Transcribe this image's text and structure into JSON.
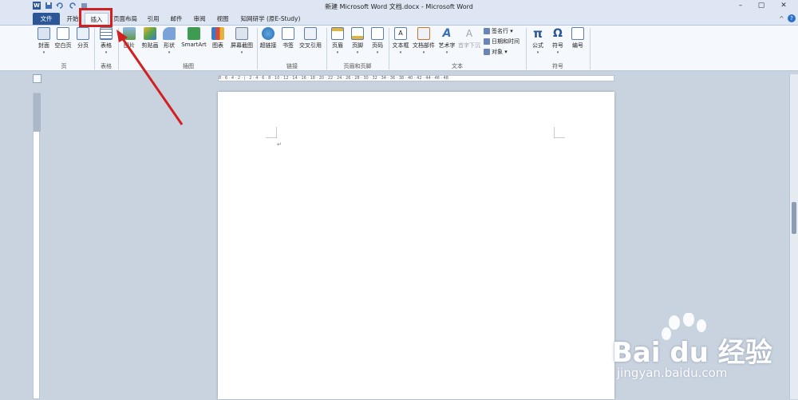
{
  "window": {
    "title": "新建 Microsoft Word 文档.docx - Microsoft Word",
    "controls": [
      "–",
      "▢",
      "✕"
    ]
  },
  "qat": {
    "icons": [
      "word-logo-icon",
      "save-icon",
      "undo-icon",
      "redo-icon",
      "customize-icon"
    ]
  },
  "tabs": [
    {
      "label": "文件"
    },
    {
      "label": "开始"
    },
    {
      "label": "插入"
    },
    {
      "label": "页面布局"
    },
    {
      "label": "引用"
    },
    {
      "label": "邮件"
    },
    {
      "label": "审阅"
    },
    {
      "label": "视图"
    },
    {
      "label": "知网研学 (原E-Study)"
    }
  ],
  "active_tab": "插入",
  "ribbon": {
    "groups": {
      "page": "页",
      "table": "表格",
      "illustrations": "插图",
      "links": "链接",
      "header_footer": "页眉和页脚",
      "text": "文本",
      "symbols": "符号"
    },
    "buttons": {
      "cover": "封面",
      "blank_page": "空白页",
      "page_break": "分页",
      "table": "表格",
      "picture": "图片",
      "clipart": "剪贴画",
      "shapes": "形状",
      "smartart": "SmartArt",
      "chart": "图表",
      "screenshot": "屏幕截图",
      "hyperlink": "超链接",
      "bookmark": "书签",
      "cross_ref": "交叉引用",
      "header": "页眉",
      "footer": "页脚",
      "page_number": "页码",
      "textbox": "文本框",
      "quick_parts": "文档部件",
      "wordart": "艺术字",
      "dropcap": "首字下沉",
      "equation": "公式",
      "symbol": "符号",
      "numbering": "编号"
    },
    "small_buttons": {
      "signature": "签名行",
      "datetime": "日期和时间",
      "object": "对象"
    }
  },
  "ruler": {
    "marks": "8 · 6 · 4 · 2 · | · 2 · 4 · 6 · 8 · 10 · 12 · 14 · 16 · 18 · 20 · 22 · 24 · 26 · 28 · 30 · 32 · 34 · 36 · 38 · 40 · 42 · 44 · 46 · 48"
  },
  "watermark": {
    "brand": "Bai du 经验",
    "url": "jingyan.baidu.com"
  },
  "colors": {
    "file_tab": "#2b5797",
    "highlight": "#d21f1f",
    "ribbon_bg": "#f5f8fc"
  }
}
